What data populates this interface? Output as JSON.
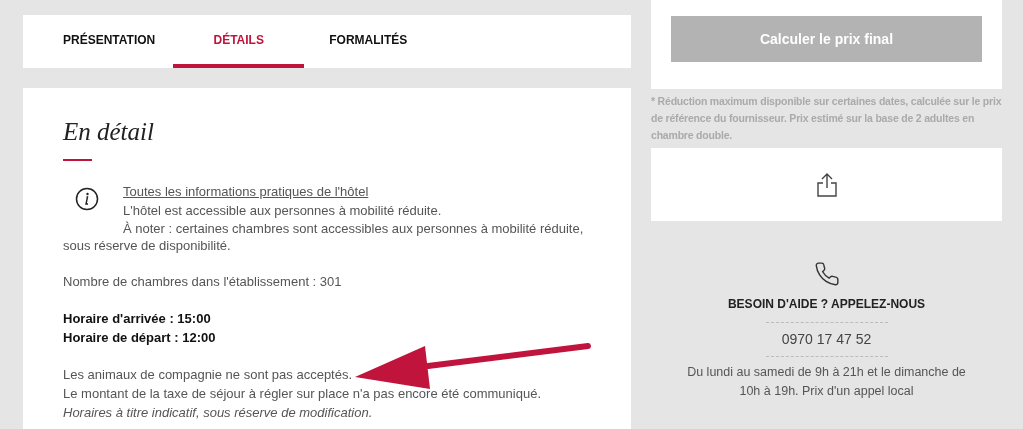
{
  "tabs": [
    {
      "label": "PRÉSENTATION",
      "selected": false
    },
    {
      "label": "DÉTAILS",
      "selected": true
    },
    {
      "label": "FORMALITÉS",
      "selected": false
    }
  ],
  "details": {
    "title": "En détail",
    "info": {
      "link": "Toutes les informations pratiques de l'hôtel",
      "line": "L'hôtel est accessible aux personnes à mobilité réduite.",
      "note": "À noter : certaines chambres sont accessibles aux personnes à mobilité réduite, sous réserve de disponibilité."
    },
    "blocks": [
      [
        {
          "text": "Nombre de chambres dans l'établissement : 301",
          "kind": "plain"
        }
      ],
      [
        {
          "text": "Horaire d'arrivée : 15:00",
          "kind": "bold"
        },
        {
          "text": "Horaire de départ : 12:00",
          "kind": "bold"
        }
      ],
      [
        {
          "text": "Les animaux de compagnie ne sont pas acceptés.",
          "kind": "plain"
        },
        {
          "text": "Le montant de la taxe de séjour à régler sur place n'a pas encore été communiqué.",
          "kind": "plain"
        },
        {
          "text": "Horaires à titre indicatif, sous réserve de modification.",
          "kind": "italic"
        }
      ]
    ]
  },
  "price": {
    "button": {
      "label": "Calculer le prix final",
      "disabled": true
    },
    "footnote": "* Réduction maximum disponible sur certaines dates, calculée sur le prix de référence du fournisseur. Prix estimé sur la base de 2 adultes en chambre double."
  },
  "help": {
    "title": "BESOIN D'AIDE ? APPELEZ-NOUS",
    "phone": "0970 17 47 52",
    "hours": "Du lundi au samedi de 9h à 21h et le dimanche de 10h à 19h. Prix d'un appel local"
  }
}
